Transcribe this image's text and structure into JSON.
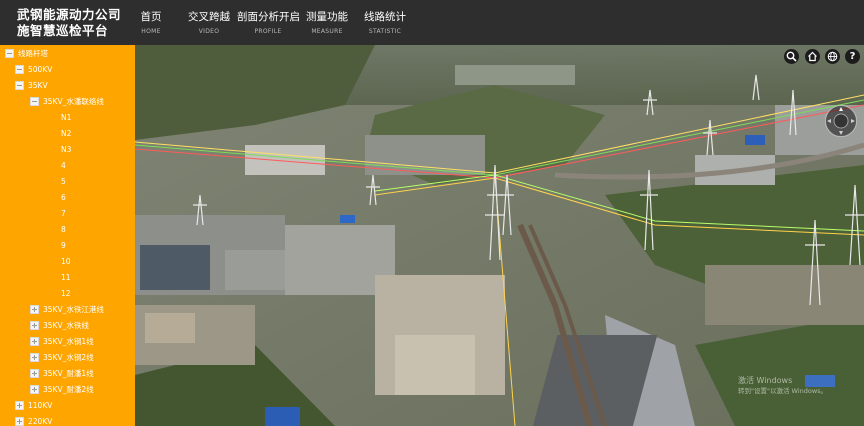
{
  "app": {
    "title_line1": "武钢能源动力公司",
    "title_line2": "施智慧巡检平台"
  },
  "nav": [
    {
      "zh": "首页",
      "en": "HOME"
    },
    {
      "zh": "交叉跨越",
      "en": "VIDEO"
    },
    {
      "zh": "剖面分析开启",
      "en": "PROFILE"
    },
    {
      "zh": "测量功能",
      "en": "MEASURE"
    },
    {
      "zh": "线路统计",
      "en": "STATISTIC"
    }
  ],
  "tree": {
    "root": "线路杆塔",
    "v500": "500KV",
    "v35": "35KV",
    "line_expanded": "35KV_水潘联络线",
    "towers": [
      "N1",
      "N2",
      "N3",
      "4",
      "5",
      "6",
      "7",
      "8",
      "9",
      "10",
      "11",
      "12"
    ],
    "lines": [
      "35KV_水铁江港线",
      "35KV_水铁线",
      "35KV_水钢1线",
      "35KV_水钢2线",
      "35KV_耐潘1线",
      "35KV_耐潘2线"
    ],
    "v110": "110KV",
    "v220": "220KV"
  },
  "toolbar": {
    "search": "search-icon",
    "home": "home-icon",
    "globe": "globe-icon",
    "help_label": "?"
  },
  "watermark": {
    "line1": "激活 Windows",
    "line2": "转到\"设置\"以激活 Windows。"
  },
  "colors": {
    "topbar": "#2e2e2e",
    "sidebar": "#ffa500",
    "text": "#ffffff"
  }
}
